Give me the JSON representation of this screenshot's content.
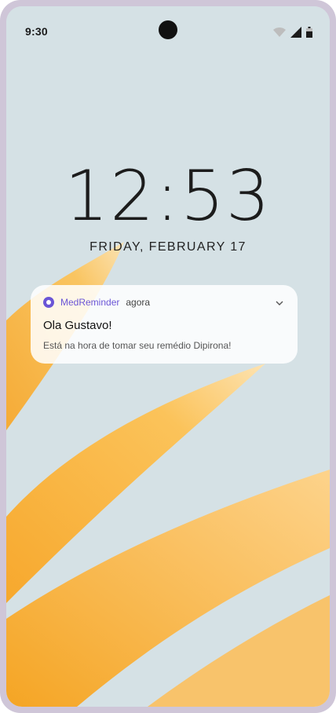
{
  "status_bar": {
    "time": "9:30"
  },
  "lock_screen": {
    "clock": "12:53",
    "date": "FRIDAY, FEBRUARY 17"
  },
  "notification": {
    "app_name": "MedReminder",
    "timestamp": "agora",
    "title": "Ola Gustavo!",
    "message": "Está na hora de tomar seu remédio Dipirona!"
  },
  "colors": {
    "accent": "#6a55d6",
    "wallpaper_bg": "#d6e2e6",
    "petal": "#f9b93e"
  },
  "icons": [
    "wifi-icon",
    "signal-icon",
    "battery-icon",
    "app-icon",
    "chevron-down-icon"
  ]
}
